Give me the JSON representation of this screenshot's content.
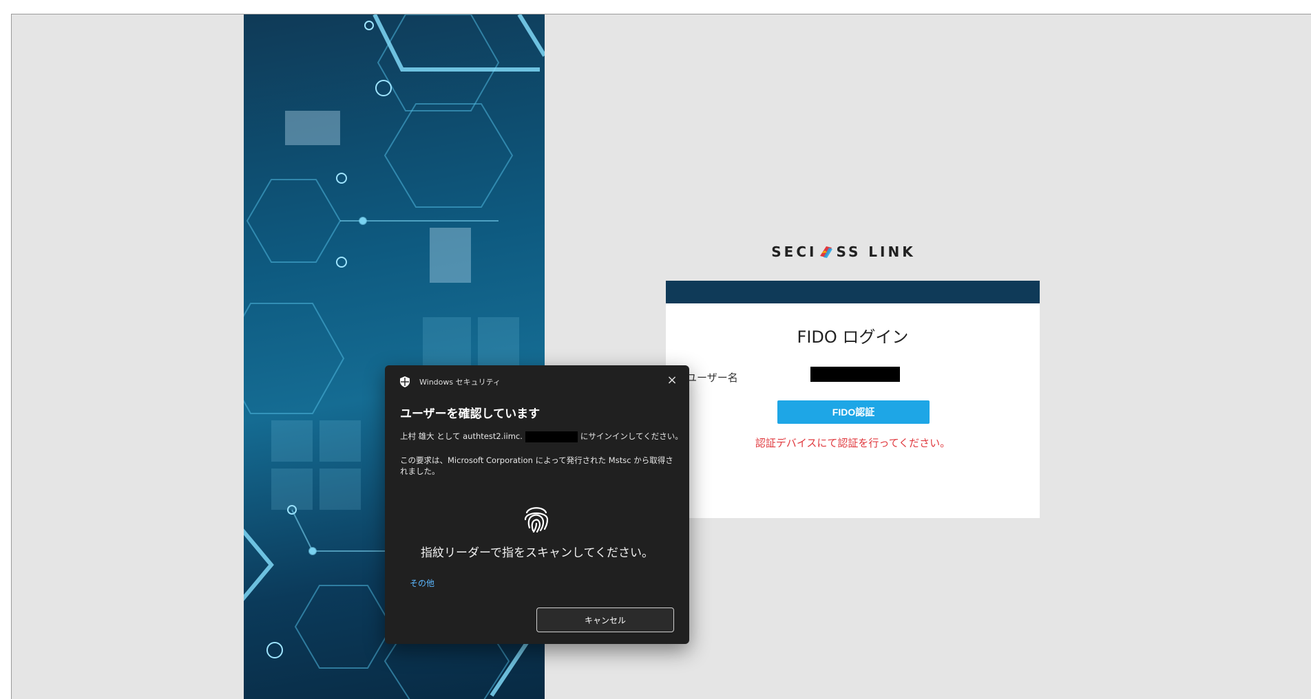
{
  "brand": {
    "text_left": "SECI",
    "text_right": "SS LINK"
  },
  "login": {
    "title": "FIDO ログイン",
    "username_label": "ユーザー名",
    "fido_button": "FIDO認証",
    "message": "認証デバイスにて認証を行ってください。"
  },
  "dialog": {
    "app_name": "Windows セキュリティ",
    "title": "ユーザーを確認しています",
    "line1_pre": "上村 雄大 として authtest2.iimc.",
    "line1_post": "にサインインしてください。",
    "line2": "この要求は、Microsoft Corporation によって発行された Mstsc から取得されました。",
    "scan_prompt": "指紋リーダーで指をスキャンしてください。",
    "other": "その他",
    "cancel": "キャンセル",
    "close_symbol": "×"
  },
  "colors": {
    "accent_blue": "#1ea6e6",
    "header_bar": "#0f3a58",
    "error_red": "#e0393e",
    "dialog_bg": "#202020"
  }
}
